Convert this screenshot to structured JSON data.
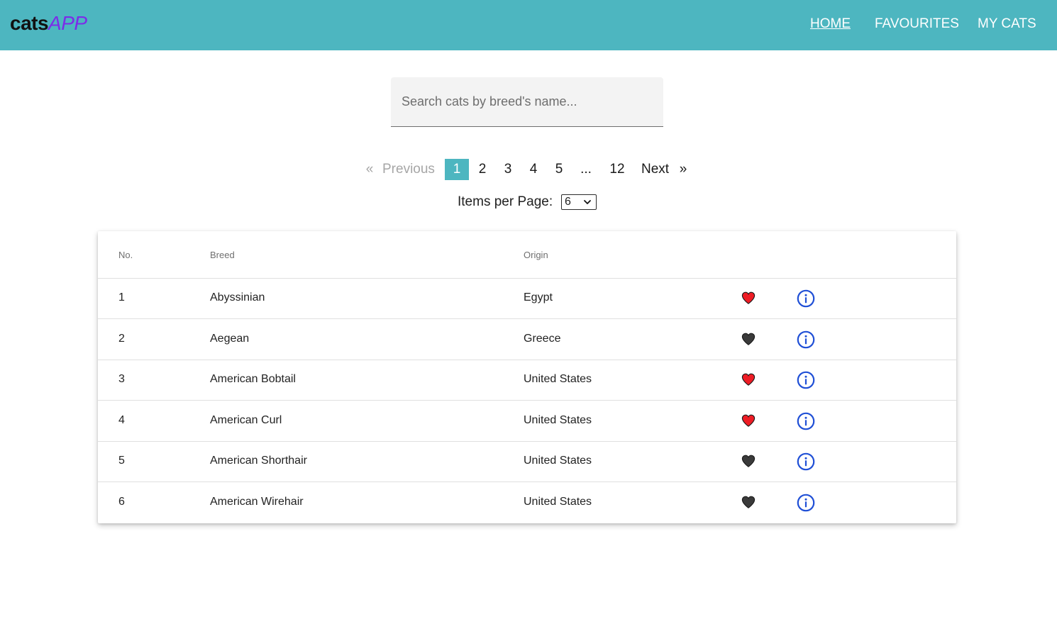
{
  "header": {
    "brand_part1": "cats",
    "brand_part2": "APP",
    "nav": [
      {
        "label": "HOME",
        "active": true
      },
      {
        "label": "FAVOURITES",
        "active": false
      },
      {
        "label": "MY CATS",
        "active": false
      }
    ]
  },
  "search": {
    "value": "",
    "placeholder": "Search cats by breed's name..."
  },
  "pagination": {
    "prev_arrow": "«",
    "prev_label": "Previous",
    "pages": [
      "1",
      "2",
      "3",
      "4",
      "5"
    ],
    "ellipsis": "...",
    "last_page": "12",
    "current_page": "1",
    "next_label": "Next",
    "next_arrow": "»",
    "items_per_page_label": "Items per Page:",
    "items_per_page_value": "6"
  },
  "table": {
    "headers": {
      "no": "No.",
      "breed": "Breed",
      "origin": "Origin"
    },
    "rows": [
      {
        "no": "1",
        "breed": "Abyssinian",
        "origin": "Egypt",
        "favourite": true
      },
      {
        "no": "2",
        "breed": "Aegean",
        "origin": "Greece",
        "favourite": false
      },
      {
        "no": "3",
        "breed": "American Bobtail",
        "origin": "United States",
        "favourite": true
      },
      {
        "no": "4",
        "breed": "American Curl",
        "origin": "United States",
        "favourite": true
      },
      {
        "no": "5",
        "breed": "American Shorthair",
        "origin": "United States",
        "favourite": false
      },
      {
        "no": "6",
        "breed": "American Wirehair",
        "origin": "United States",
        "favourite": false
      }
    ]
  },
  "icons": {
    "favourite_on": "heart-icon-red",
    "favourite_off": "heart-icon-dark",
    "details": "info-icon"
  },
  "colors": {
    "header_bg": "#4db6c0",
    "brand_accent": "#7c2ce8",
    "active_page_bg": "#4db6c0",
    "heart_on": "#ee1c25",
    "heart_off": "#3a3a3a",
    "info_icon": "#1f4fd6"
  }
}
